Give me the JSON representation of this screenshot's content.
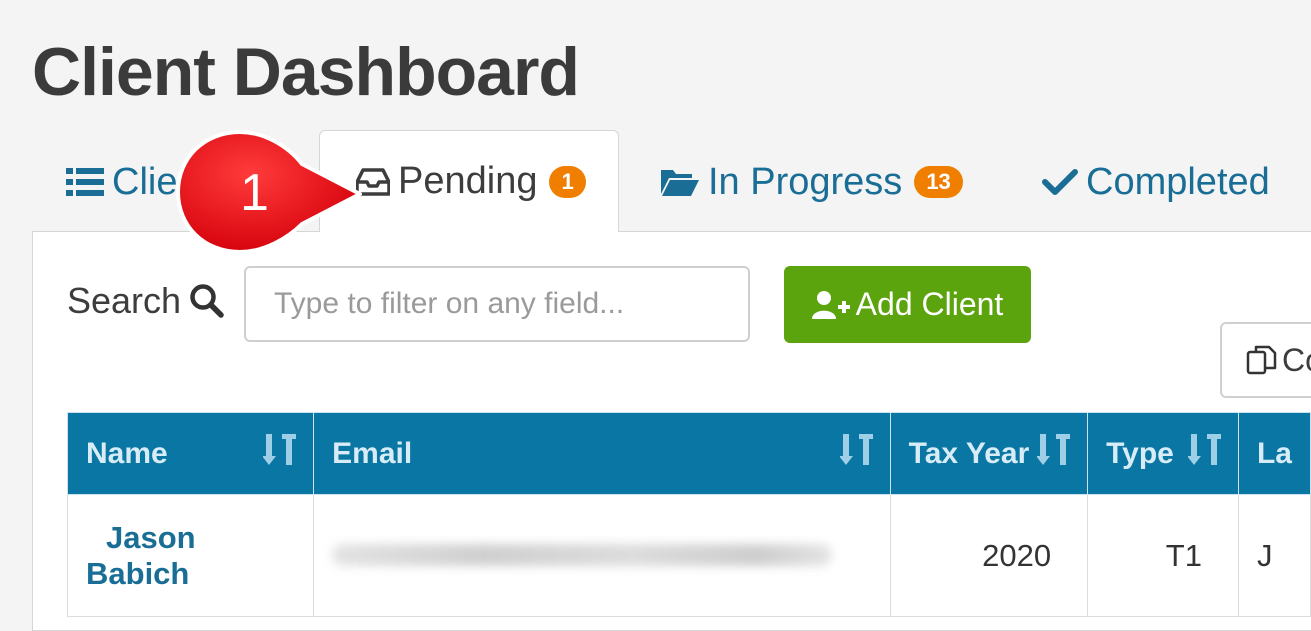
{
  "page": {
    "title": "Client Dashboard"
  },
  "tabs": {
    "clients": {
      "label": "Clie"
    },
    "pending": {
      "label": "Pending",
      "count": "1"
    },
    "in_progress": {
      "label": "In Progress",
      "count": "13"
    },
    "completed": {
      "label": "Completed"
    }
  },
  "callout": {
    "number": "1"
  },
  "toolbar": {
    "search_label": "Search",
    "search_placeholder": "Type to filter on any field...",
    "add_client_label": "Add Client",
    "copy_label": "Co"
  },
  "table": {
    "columns": [
      "Name",
      "Email",
      "Tax Year",
      "Type",
      "La"
    ],
    "rows": [
      {
        "name": "Jason Babich",
        "tax_year": "2020",
        "type": "T1",
        "last": "J"
      }
    ]
  },
  "colors": {
    "accent": "#1a6e96",
    "header_bg": "#0a76a3",
    "badge": "#f07e00",
    "add_button": "#5ba40e",
    "callout": "#e8141c"
  }
}
